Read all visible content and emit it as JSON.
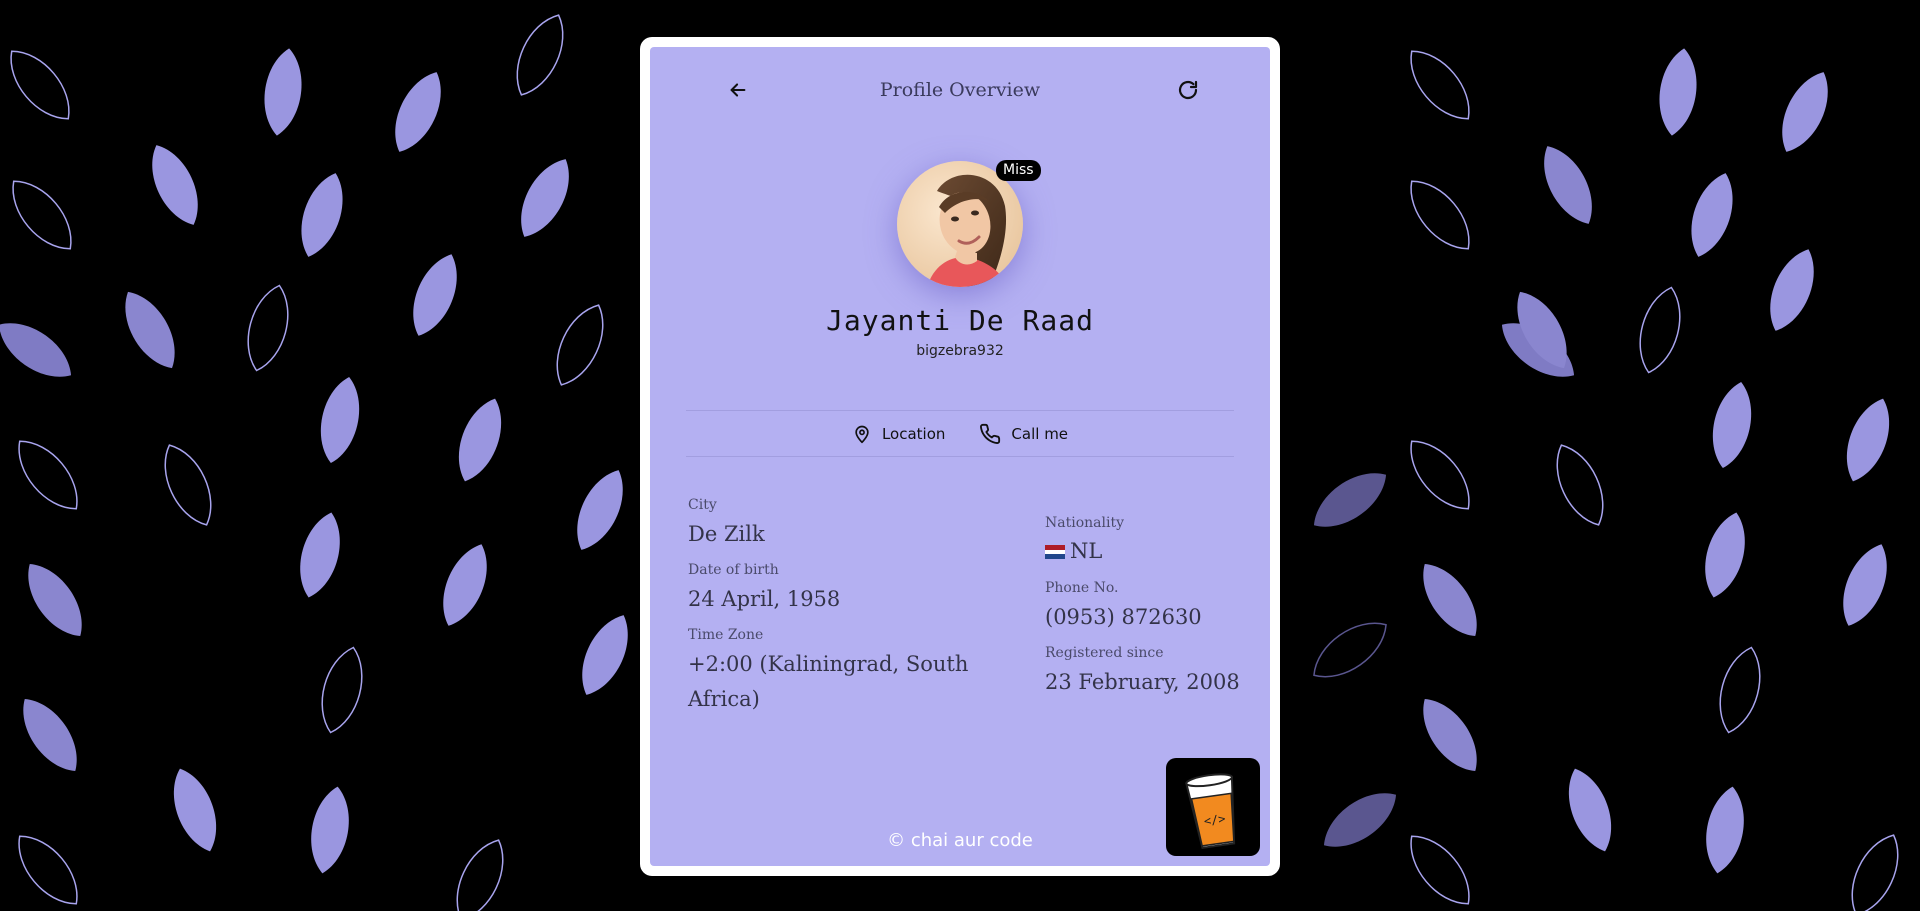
{
  "header": {
    "title": "Profile Overview",
    "back_icon": "arrow-left-icon",
    "refresh_icon": "refresh-icon"
  },
  "profile": {
    "title_badge": "Miss",
    "full_name": "Jayanti De Raad",
    "username": "bigzebra932"
  },
  "actions": {
    "location_label": "Location",
    "call_label": "Call me",
    "location_icon": "map-pin-icon",
    "call_icon": "phone-icon"
  },
  "details": {
    "city_label": "City",
    "city_value": "De Zilk",
    "dob_label": "Date of birth",
    "dob_value": "24 April, 1958",
    "timezone_label": "Time Zone",
    "timezone_value": "+2:00 (Kaliningrad, South Africa)",
    "nationality_label": "Nationality",
    "nationality_value": "NL",
    "phone_label": "Phone No.",
    "phone_value": "(0953) 872630",
    "registered_label": "Registered since",
    "registered_value": "23 February, 2008"
  },
  "footer": {
    "text": "© chai aur code"
  },
  "colors": {
    "page_background": "#000000",
    "card_border": "#ffffff",
    "card_background": "#b4b0f2",
    "leaf_fill": "#9a96e0",
    "badge_background": "#000000"
  }
}
